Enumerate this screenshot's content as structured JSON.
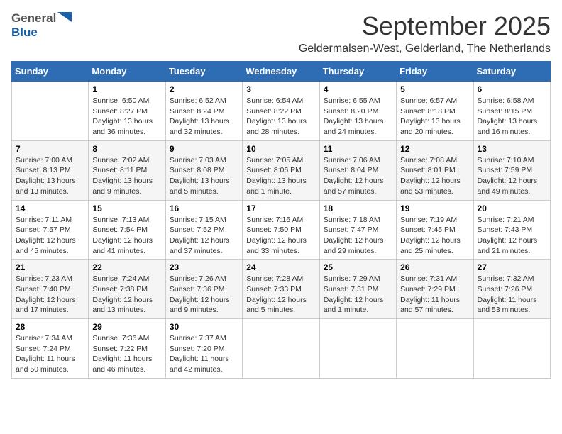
{
  "logo": {
    "general": "General",
    "blue": "Blue"
  },
  "title": {
    "month_year": "September 2025",
    "location": "Geldermalsen-West, Gelderland, The Netherlands"
  },
  "calendar": {
    "headers": [
      "Sunday",
      "Monday",
      "Tuesday",
      "Wednesday",
      "Thursday",
      "Friday",
      "Saturday"
    ],
    "weeks": [
      [
        {
          "day": "",
          "info": ""
        },
        {
          "day": "1",
          "info": "Sunrise: 6:50 AM\nSunset: 8:27 PM\nDaylight: 13 hours\nand 36 minutes."
        },
        {
          "day": "2",
          "info": "Sunrise: 6:52 AM\nSunset: 8:24 PM\nDaylight: 13 hours\nand 32 minutes."
        },
        {
          "day": "3",
          "info": "Sunrise: 6:54 AM\nSunset: 8:22 PM\nDaylight: 13 hours\nand 28 minutes."
        },
        {
          "day": "4",
          "info": "Sunrise: 6:55 AM\nSunset: 8:20 PM\nDaylight: 13 hours\nand 24 minutes."
        },
        {
          "day": "5",
          "info": "Sunrise: 6:57 AM\nSunset: 8:18 PM\nDaylight: 13 hours\nand 20 minutes."
        },
        {
          "day": "6",
          "info": "Sunrise: 6:58 AM\nSunset: 8:15 PM\nDaylight: 13 hours\nand 16 minutes."
        }
      ],
      [
        {
          "day": "7",
          "info": "Sunrise: 7:00 AM\nSunset: 8:13 PM\nDaylight: 13 hours\nand 13 minutes."
        },
        {
          "day": "8",
          "info": "Sunrise: 7:02 AM\nSunset: 8:11 PM\nDaylight: 13 hours\nand 9 minutes."
        },
        {
          "day": "9",
          "info": "Sunrise: 7:03 AM\nSunset: 8:08 PM\nDaylight: 13 hours\nand 5 minutes."
        },
        {
          "day": "10",
          "info": "Sunrise: 7:05 AM\nSunset: 8:06 PM\nDaylight: 13 hours\nand 1 minute."
        },
        {
          "day": "11",
          "info": "Sunrise: 7:06 AM\nSunset: 8:04 PM\nDaylight: 12 hours\nand 57 minutes."
        },
        {
          "day": "12",
          "info": "Sunrise: 7:08 AM\nSunset: 8:01 PM\nDaylight: 12 hours\nand 53 minutes."
        },
        {
          "day": "13",
          "info": "Sunrise: 7:10 AM\nSunset: 7:59 PM\nDaylight: 12 hours\nand 49 minutes."
        }
      ],
      [
        {
          "day": "14",
          "info": "Sunrise: 7:11 AM\nSunset: 7:57 PM\nDaylight: 12 hours\nand 45 minutes."
        },
        {
          "day": "15",
          "info": "Sunrise: 7:13 AM\nSunset: 7:54 PM\nDaylight: 12 hours\nand 41 minutes."
        },
        {
          "day": "16",
          "info": "Sunrise: 7:15 AM\nSunset: 7:52 PM\nDaylight: 12 hours\nand 37 minutes."
        },
        {
          "day": "17",
          "info": "Sunrise: 7:16 AM\nSunset: 7:50 PM\nDaylight: 12 hours\nand 33 minutes."
        },
        {
          "day": "18",
          "info": "Sunrise: 7:18 AM\nSunset: 7:47 PM\nDaylight: 12 hours\nand 29 minutes."
        },
        {
          "day": "19",
          "info": "Sunrise: 7:19 AM\nSunset: 7:45 PM\nDaylight: 12 hours\nand 25 minutes."
        },
        {
          "day": "20",
          "info": "Sunrise: 7:21 AM\nSunset: 7:43 PM\nDaylight: 12 hours\nand 21 minutes."
        }
      ],
      [
        {
          "day": "21",
          "info": "Sunrise: 7:23 AM\nSunset: 7:40 PM\nDaylight: 12 hours\nand 17 minutes."
        },
        {
          "day": "22",
          "info": "Sunrise: 7:24 AM\nSunset: 7:38 PM\nDaylight: 12 hours\nand 13 minutes."
        },
        {
          "day": "23",
          "info": "Sunrise: 7:26 AM\nSunset: 7:36 PM\nDaylight: 12 hours\nand 9 minutes."
        },
        {
          "day": "24",
          "info": "Sunrise: 7:28 AM\nSunset: 7:33 PM\nDaylight: 12 hours\nand 5 minutes."
        },
        {
          "day": "25",
          "info": "Sunrise: 7:29 AM\nSunset: 7:31 PM\nDaylight: 12 hours\nand 1 minute."
        },
        {
          "day": "26",
          "info": "Sunrise: 7:31 AM\nSunset: 7:29 PM\nDaylight: 11 hours\nand 57 minutes."
        },
        {
          "day": "27",
          "info": "Sunrise: 7:32 AM\nSunset: 7:26 PM\nDaylight: 11 hours\nand 53 minutes."
        }
      ],
      [
        {
          "day": "28",
          "info": "Sunrise: 7:34 AM\nSunset: 7:24 PM\nDaylight: 11 hours\nand 50 minutes."
        },
        {
          "day": "29",
          "info": "Sunrise: 7:36 AM\nSunset: 7:22 PM\nDaylight: 11 hours\nand 46 minutes."
        },
        {
          "day": "30",
          "info": "Sunrise: 7:37 AM\nSunset: 7:20 PM\nDaylight: 11 hours\nand 42 minutes."
        },
        {
          "day": "",
          "info": ""
        },
        {
          "day": "",
          "info": ""
        },
        {
          "day": "",
          "info": ""
        },
        {
          "day": "",
          "info": ""
        }
      ]
    ]
  }
}
